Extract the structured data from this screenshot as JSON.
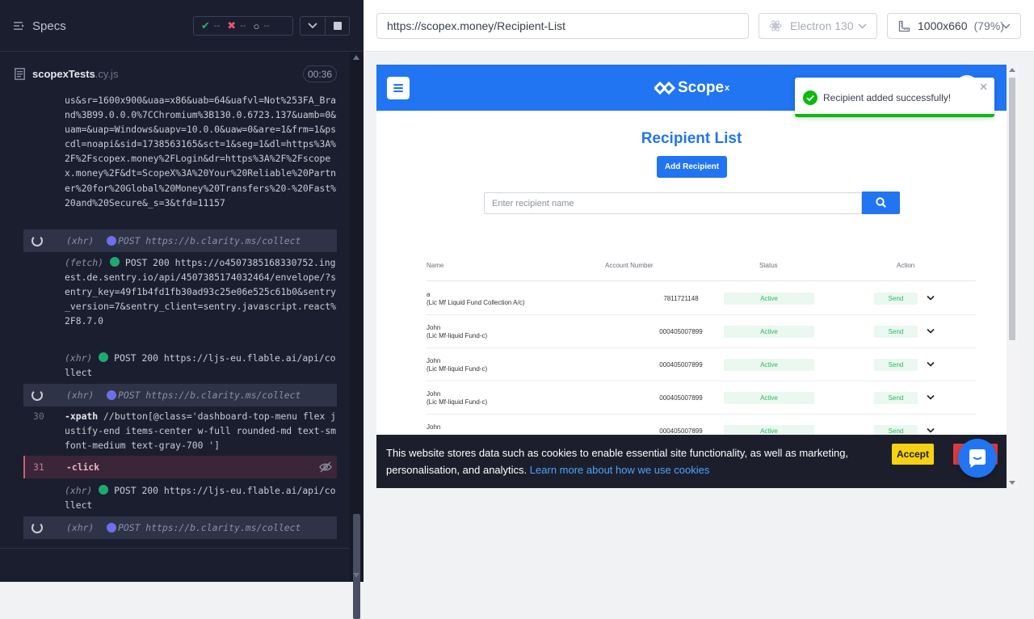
{
  "runner": {
    "specs_title": "Specs",
    "stats": {
      "passed": "--",
      "failed": "--",
      "pending": "--"
    },
    "file_name": "scopexTests",
    "file_ext": ".cy.js",
    "timer": "00:36"
  },
  "log": {
    "url_fragment": "us&sr=1600x900&uaa=x86&uab=64&uafvl=Not%253FA_Brand%3B99.0.0.0%7CChromium%3B130.0.6723.137&uamb=0&uam=&uap=Windows&uapv=10.0.0&uaw=0&are=1&frm=1&pscdl=noapi&sid=1738563165&sct=1&seg=1&dl=https%3A%2F%2Fscopex.money%2FLogin&dr=https%3A%2F%2Fscopex.money%2F&dt=ScopeX%3A%20Your%20Reliable%20Partner%20for%20Global%20Money%20Transfers%20-%20Fast%20and%20Secure&_s=3&tfd=11157",
    "xhr1": {
      "kind": "(xhr)",
      "text": "POST https://b.clarity.ms/collect"
    },
    "fetch1": {
      "kind": "(fetch)",
      "text": "POST 200 https://o4507385168330752.ingest.de.sentry.io/api/4507385174032464/envelope/?sentry_key=49f1b4fd1fb30ad93c25e06e525c61b0&sentry_version=7&sentry_client=sentry.javascript.react%2F8.7.0"
    },
    "xhr2": {
      "kind": "(xhr)",
      "text": "POST 200 https://ljs-eu.flable.ai/api/collect"
    },
    "xhr3": {
      "kind": "(xhr)",
      "text": "POST https://b.clarity.ms/collect"
    },
    "xpath": {
      "line": "30",
      "name": "-xpath",
      "arg": "//button[@class='dashboard-top-menu flex justify-end items-center w-full rounded-md text-sm font-medium text-gray-700 ']"
    },
    "click": {
      "line": "31",
      "name": "-click"
    },
    "xhr4": {
      "kind": "(xhr)",
      "text": "POST 200 https://ljs-eu.flable.ai/api/collect"
    },
    "xhr5": {
      "kind": "(xhr)",
      "text": "POST https://b.clarity.ms/collect"
    }
  },
  "toolbar": {
    "url": "https://scopex.money/Recipient-List",
    "browser": "Electron 130",
    "viewport": "1000x660",
    "zoom": "(79%)"
  },
  "app": {
    "logo": "Scope",
    "logo_sup": "x",
    "title": "Recipient List",
    "add_button": "Add Recipient",
    "search_placeholder": "Enter recipient name",
    "columns": [
      "Name",
      "Account Number",
      "Status",
      "Action"
    ],
    "rows": [
      {
        "name": "a",
        "fund": "(Lic Mf Liquid Fund Collection A/c)",
        "account": "7811721148",
        "status": "Active",
        "action": "Send"
      },
      {
        "name": "John",
        "fund": "(Lic Mf-liquid Fund-c)",
        "account": "000405007899",
        "status": "Active",
        "action": "Send"
      },
      {
        "name": "John",
        "fund": "(Lic Mf-liquid Fund-c)",
        "account": "000405007899",
        "status": "Active",
        "action": "Send"
      },
      {
        "name": "John",
        "fund": "(Lic Mf-liquid Fund-c)",
        "account": "000405007899",
        "status": "Active",
        "action": "Send"
      },
      {
        "name": "John",
        "fund": "",
        "account": "000405007899",
        "status": "Active",
        "action": "Send"
      }
    ],
    "toast": "Recipient added successfully!",
    "cookie_text": "This website stores data such as cookies to enable essential site functionality, as well as marketing, personalisation, and analytics.",
    "cookie_link": "Learn more about how we use cookies",
    "accept": "Accept"
  },
  "colors": {
    "brand": "#2175f3",
    "success": "#07bc0c",
    "runner_bg": "#1b1e2e"
  }
}
